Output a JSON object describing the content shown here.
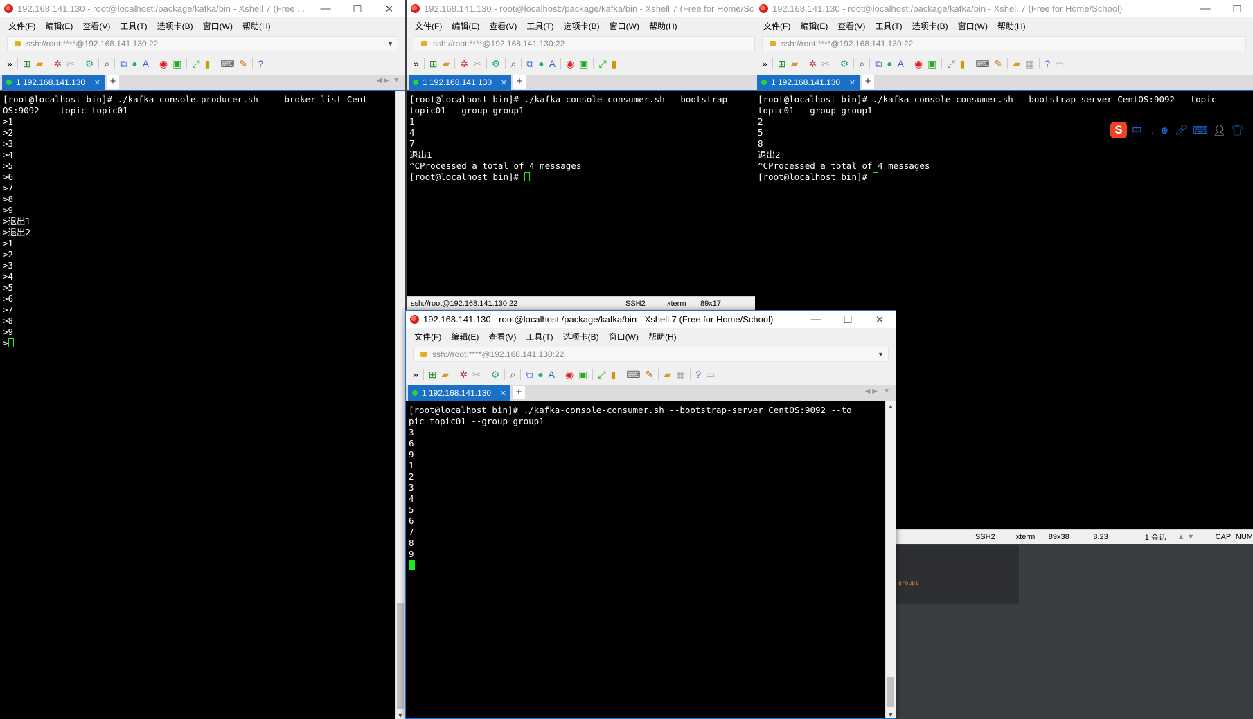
{
  "windows": {
    "producer": {
      "title": "192.168.141.130 - root@localhost:/package/kafka/bin - Xshell 7 (Free ...",
      "tab_label": "1 192.168.141.130",
      "address": "ssh://root:****@192.168.141.130:22",
      "terminal_lines": [
        "[root@localhost bin]# ./kafka-console-producer.sh   --broker-list Cent",
        "OS:9092  --topic topic01",
        ">1",
        ">2",
        ">3",
        ">4",
        ">5",
        ">6",
        ">7",
        ">8",
        ">9",
        ">退出1",
        ">退出2",
        ">1",
        ">2",
        ">3",
        ">4",
        ">5",
        ">6",
        ">7",
        ">8",
        ">9"
      ],
      "prompt_last": ">"
    },
    "consumer1": {
      "title": "192.168.141.130 - root@localhost:/package/kafka/bin - Xshell 7 (Free for Home/Sc",
      "tab_label": "1 192.168.141.130",
      "address": "ssh://root:****@192.168.141.130:22",
      "terminal_lines": [
        "[root@localhost bin]# ./kafka-console-consumer.sh --bootstrap-",
        "topic01 --group group1",
        "1",
        "4",
        "7",
        "退出1",
        "^CProcessed a total of 4 messages"
      ],
      "prompt_last": "[root@localhost bin]# ",
      "status": {
        "conn": "ssh://root@192.168.141.130:22",
        "proto": "SSH2",
        "term": "xterm",
        "size": "89x17"
      }
    },
    "consumer2": {
      "title": "192.168.141.130 - root@localhost:/package/kafka/bin - Xshell 7 (Free for Home/School)",
      "tab_label": "1 192.168.141.130",
      "address": "ssh://root:****@192.168.141.130:22",
      "terminal_lines": [
        "[root@localhost bin]# ./kafka-console-consumer.sh --bootstrap-server CentOS:9092 --topic",
        "topic01 --group group1",
        "2",
        "5",
        "8",
        "退出2",
        "^CProcessed a total of 4 messages"
      ],
      "prompt_last": "[root@localhost bin]# ",
      "status": {
        "proto": "SSH2",
        "term": "xterm",
        "size": "89x38",
        "pos": "8,23",
        "sessions": "1 会话",
        "cap": "CAP",
        "num": "NUM"
      }
    },
    "consumer3": {
      "title": "192.168.141.130 - root@localhost:/package/kafka/bin - Xshell 7 (Free for Home/School)",
      "tab_label": "1 192.168.141.130",
      "address": "ssh://root:****@192.168.141.130:22",
      "terminal_lines": [
        "[root@localhost bin]# ./kafka-console-consumer.sh --bootstrap-server CentOS:9092 --to",
        "pic topic01 --group group1",
        "3",
        "6",
        "9",
        "1",
        "2",
        "3",
        "4",
        "5",
        "6",
        "7",
        "8",
        "9"
      ]
    }
  },
  "menu": [
    "文件(F)",
    "编辑(E)",
    "查看(V)",
    "工具(T)",
    "选项卡(B)",
    "窗口(W)",
    "帮助(H)"
  ],
  "window_controls": {
    "minimize": "—",
    "maximize": "☐",
    "close": "✕"
  },
  "ime": {
    "logo": "S",
    "mode": "中",
    "punct": "°,"
  },
  "background_text": "group1",
  "colors": {
    "accent": "#1a6fc7",
    "cursor": "#21e621",
    "ime": "#1d62c9"
  }
}
